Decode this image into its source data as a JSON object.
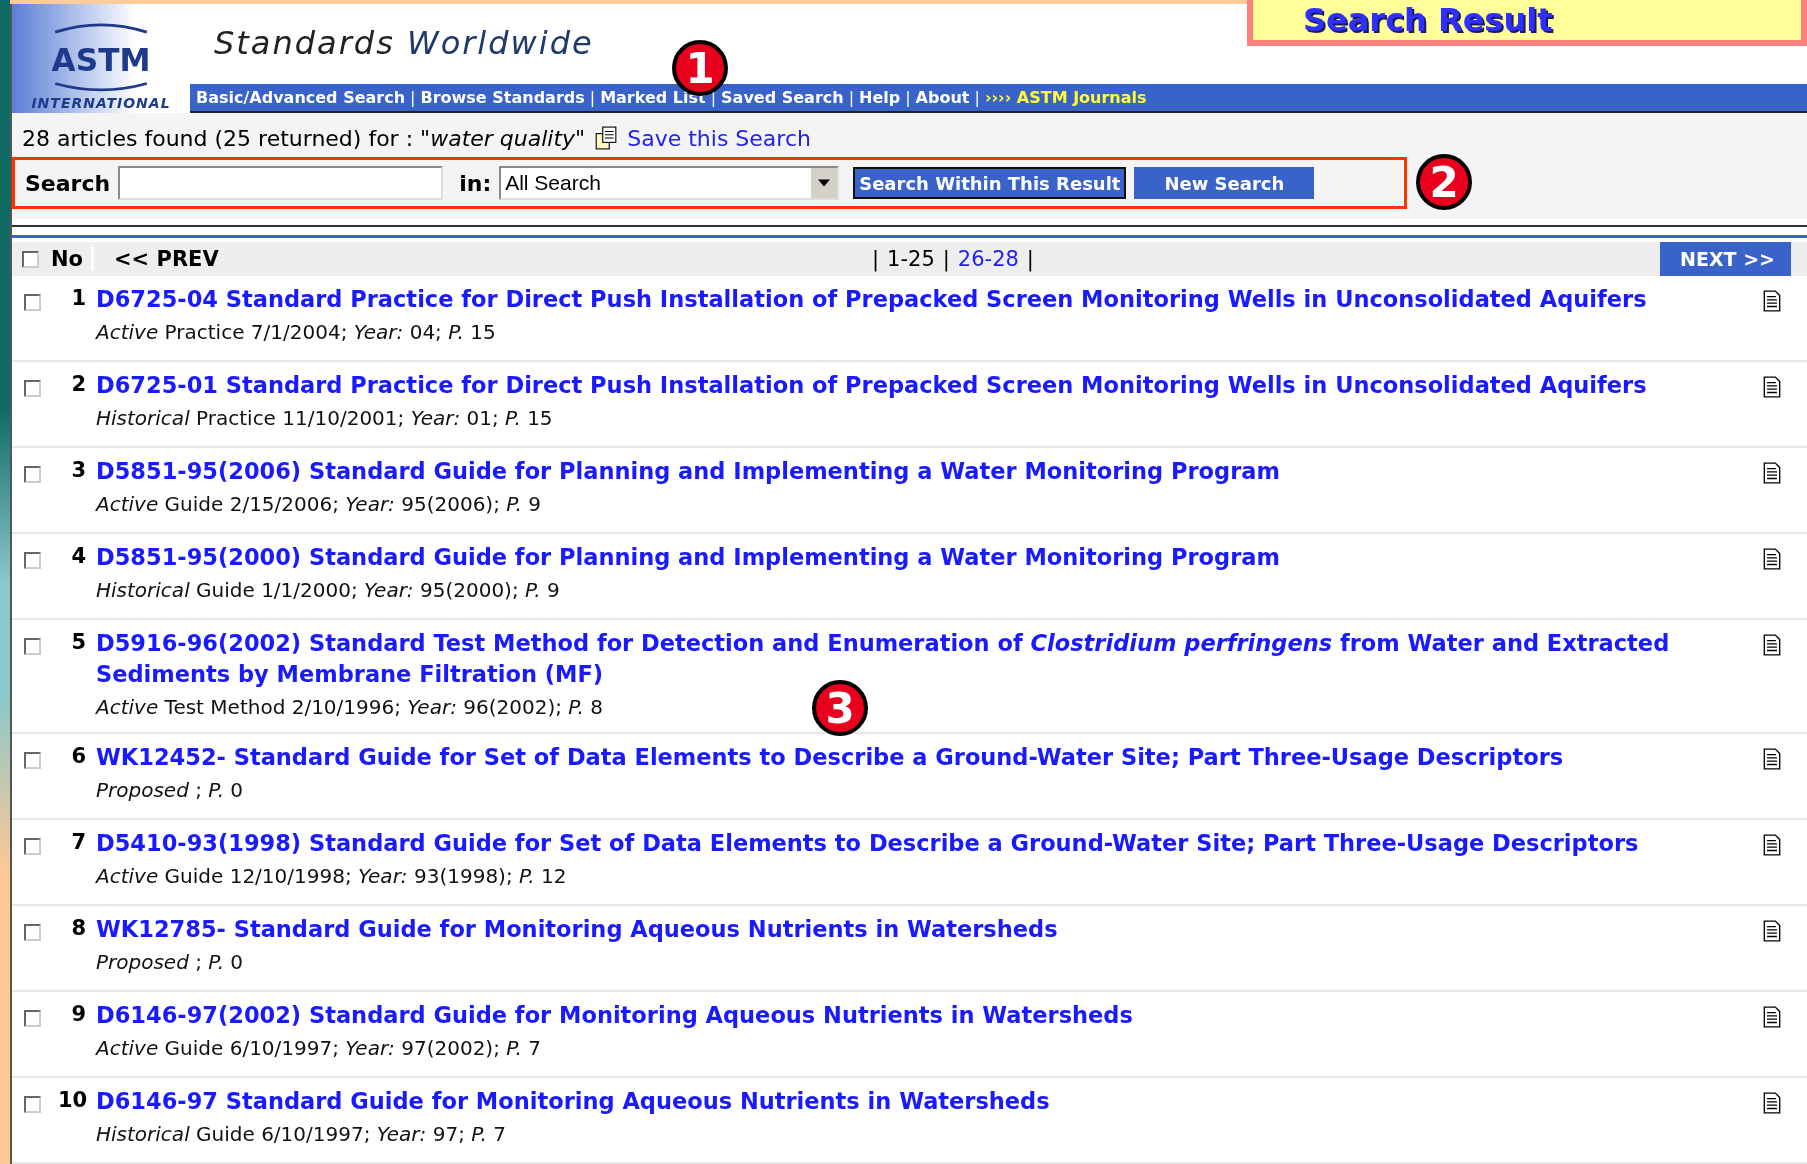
{
  "slide_title": "Search Result",
  "header": {
    "logo_text": "ASTM",
    "logo_caption": "INTERNATIONAL",
    "tagline_1": "Standards",
    "tagline_2": "Worldwide"
  },
  "nav": {
    "separator": "|",
    "items": [
      {
        "label": "Basic/Advanced Search",
        "kind": "link"
      },
      {
        "label": "Browse Standards",
        "kind": "link"
      },
      {
        "label": "Marked List",
        "kind": "link"
      },
      {
        "label": "Saved Search",
        "kind": "link"
      },
      {
        "label": "Help",
        "kind": "link"
      },
      {
        "label": "About",
        "kind": "link"
      },
      {
        "label": "›››› ASTM Journals",
        "kind": "highlight"
      }
    ]
  },
  "summary": {
    "text": "28 articles found (25 returned) for :",
    "query": "\"water quality\"",
    "save_link": "Save this Search"
  },
  "search": {
    "label": "Search",
    "in_label": "in:",
    "scope": "All Search",
    "within_button": "Search Within This Result",
    "new_button": "New Search"
  },
  "pager": {
    "select_all_checked": false,
    "no_label": "No",
    "prev": "<< PREV",
    "separator": "|",
    "next": "NEXT >>",
    "ranges": [
      {
        "label": "1-25",
        "selected": true
      },
      {
        "label": "26-28",
        "selected": false
      }
    ]
  },
  "results": [
    {
      "number": "1",
      "checked": false,
      "title": "D6725-04 Standard Practice for Direct Push Installation of Prepacked Screen Monitoring Wells in Unconsolidated Aquifers",
      "meta": "*Active* Practice 7/1/2004; *Year:* 04; *P.* 15"
    },
    {
      "number": "2",
      "checked": false,
      "title": "D6725-01 Standard Practice for Direct Push Installation of Prepacked Screen Monitoring Wells in Unconsolidated Aquifers",
      "meta": "*Historical* Practice 11/10/2001; *Year:* 01; *P.* 15"
    },
    {
      "number": "3",
      "checked": false,
      "title": "D5851-95(2006) Standard Guide for Planning and Implementing a Water Monitoring Program",
      "meta": "*Active* Guide 2/15/2006; *Year:* 95(2006); *P.* 9"
    },
    {
      "number": "4",
      "checked": false,
      "title": "D5851-95(2000) Standard Guide for Planning and Implementing a Water Monitoring Program",
      "meta": "*Historical* Guide 1/1/2000; *Year:* 95(2000); *P.* 9"
    },
    {
      "number": "5",
      "checked": false,
      "title": "D5916-96(2002) Standard Test Method for Detection and Enumeration of *Clostridium perfringens* from Water and Extracted Sediments by Membrane Filtration (MF)",
      "meta": "*Active* Test Method 2/10/1996; *Year:* 96(2002); *P.* 8"
    },
    {
      "number": "6",
      "checked": false,
      "title": "WK12452- Standard Guide for Set of Data Elements to Describe a Ground-Water Site; Part Three-Usage Descriptors",
      "meta": "*Proposed* ; *P.* 0"
    },
    {
      "number": "7",
      "checked": false,
      "title": "D5410-93(1998) Standard Guide for Set of Data Elements to Describe a Ground-Water Site; Part Three-Usage Descriptors",
      "meta": "*Active* Guide 12/10/1998; *Year:* 93(1998); *P.* 12"
    },
    {
      "number": "8",
      "checked": false,
      "title": "WK12785- Standard Guide for Monitoring Aqueous Nutrients in Watersheds",
      "meta": "*Proposed* ; *P.* 0"
    },
    {
      "number": "9",
      "checked": false,
      "title": "D6146-97(2002) Standard Guide for Monitoring Aqueous Nutrients in Watersheds",
      "meta": "*Active* Guide 6/10/1997; *Year:* 97(2002); *P.* 7"
    },
    {
      "number": "10",
      "checked": false,
      "title": "D6146-97 Standard Guide for Monitoring Aqueous Nutrients in Watersheds",
      "meta": "*Historical* Guide 6/10/1997; *Year:* 97; *P.* 7"
    }
  ],
  "callouts": [
    {
      "number": "1"
    },
    {
      "number": "2"
    },
    {
      "number": "3"
    }
  ]
}
